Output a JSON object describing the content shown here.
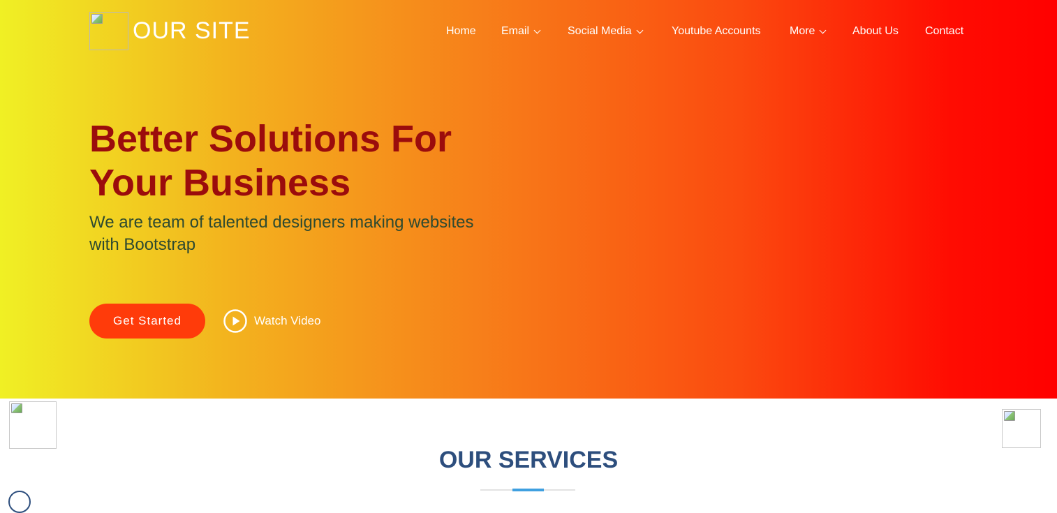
{
  "header": {
    "logo_text": "OUR SITE",
    "nav": [
      {
        "label": "Home",
        "has_dropdown": false
      },
      {
        "label": "Email",
        "has_dropdown": true
      },
      {
        "label": "Social Media",
        "has_dropdown": true
      },
      {
        "label": "Youtube Accounts",
        "has_dropdown": false
      },
      {
        "label": "More",
        "has_dropdown": true
      },
      {
        "label": "About Us",
        "has_dropdown": false
      },
      {
        "label": "Contact",
        "has_dropdown": false
      }
    ]
  },
  "hero": {
    "title": "Better Solutions For Your Business",
    "subtitle": "We are team of talented designers making websites with Bootstrap",
    "primary_button": "Get Started",
    "video_link": "Watch Video",
    "gradient_colors": [
      "#f0f024",
      "#f7801a",
      "#ff0000"
    ],
    "title_color": "#9b0c0c",
    "button_color": "#ff3b0a"
  },
  "services": {
    "title": "OUR SERVICES",
    "title_color": "#2d4e7d",
    "accent_color": "#3fa0e0"
  },
  "icons": {
    "play": "play-circle-icon",
    "dropdown": "chevron-down-icon",
    "broken_image": "broken-image-icon"
  }
}
